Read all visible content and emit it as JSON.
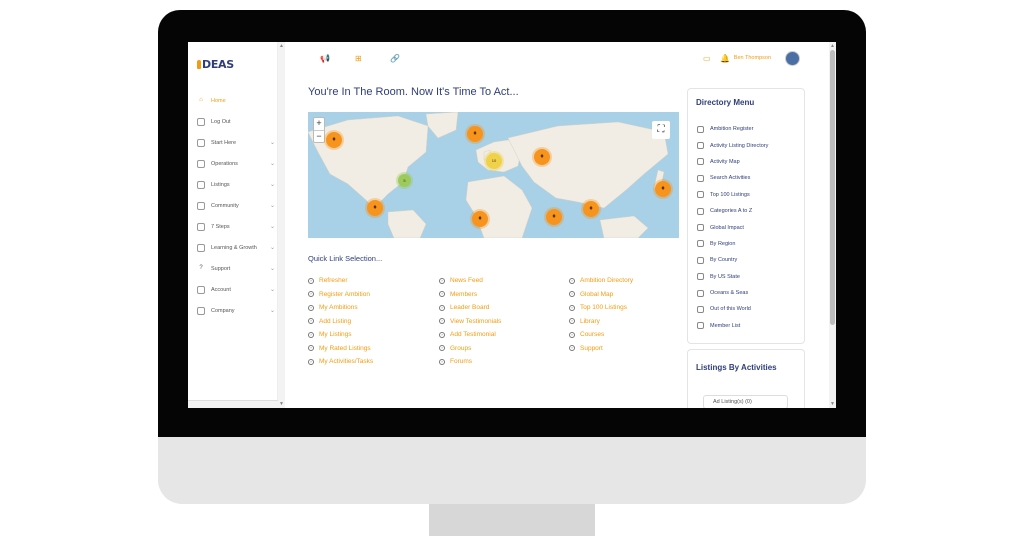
{
  "logo": {
    "text": "DEAS",
    "sub": ""
  },
  "sidebar": {
    "items": [
      {
        "label": "Home",
        "icon": "home-icon",
        "active": true
      },
      {
        "label": "Log Out",
        "icon": "logout-icon"
      },
      {
        "label": "Start Here",
        "icon": "megaphone-icon"
      },
      {
        "label": "Operations",
        "icon": "plus-square-icon"
      },
      {
        "label": "Listings",
        "icon": "listing-icon"
      },
      {
        "label": "Community",
        "icon": "community-icon"
      },
      {
        "label": "7 Steps",
        "icon": "steps-icon"
      },
      {
        "label": "Learning & Growth",
        "icon": "learning-icon"
      },
      {
        "label": "Support",
        "icon": "question-icon"
      },
      {
        "label": "Account",
        "icon": "account-icon"
      },
      {
        "label": "Company",
        "icon": "flag-icon"
      }
    ]
  },
  "header": {
    "icons": [
      "megaphone-icon",
      "plus-square-icon",
      "link-icon"
    ],
    "right_icons": [
      "inbox-icon",
      "bell-icon"
    ],
    "user_name": "Ben Thompson"
  },
  "main": {
    "title": "You're In The Room. Now It's Time To Act...",
    "map": {
      "zoom_in": "+",
      "zoom_out": "−",
      "cluster_labels": [
        "10",
        "5"
      ]
    },
    "quick_links_title": "Quick Link Selection...",
    "quick_links": [
      [
        "Refresher",
        "Register Ambition",
        "My Ambitions",
        "Add Listing",
        "My Listings",
        "My Rated Listings",
        "My Activities/Tasks"
      ],
      [
        "News Feed",
        "Members",
        "Leader Board",
        "View Testimonials",
        "Add Testimonial",
        "Groups",
        "Forums"
      ],
      [
        "Ambition Directory",
        "Global Map",
        "Top 100 Listings",
        "Library",
        "Courses",
        "Support"
      ]
    ]
  },
  "directory": {
    "title": "Directory Menu",
    "items": [
      "Ambition Register",
      "Activity Listing Directory",
      "Activity Map",
      "Search Activities",
      "Top 100 Listings",
      "Categories A to Z",
      "Global Impact",
      "By Region",
      "By Country",
      "By US State",
      "Oceans & Seas",
      "Out of this World",
      "Member List"
    ]
  },
  "listings_by_activities": {
    "title": "Listings By Activities",
    "select_value": "Ad Listing(s) (0)"
  },
  "colors": {
    "accent": "#f39c12",
    "navy": "#2f3e7a",
    "ocean": "#a8d0e6",
    "land": "#f1ede4"
  }
}
